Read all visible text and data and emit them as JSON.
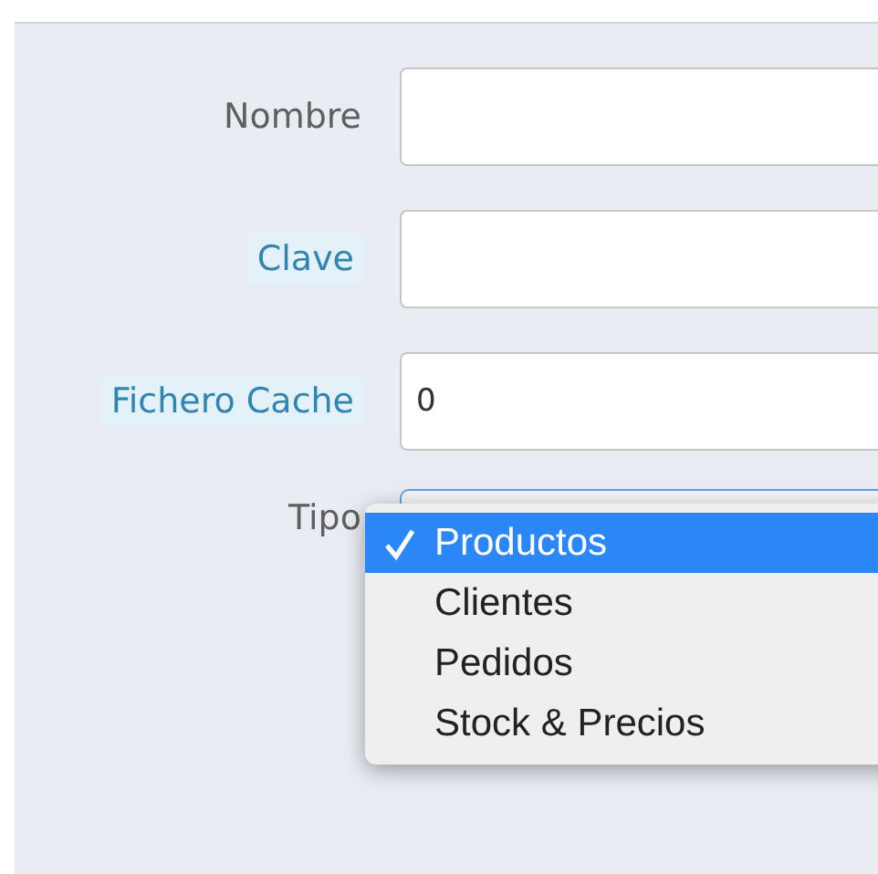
{
  "fields": [
    {
      "label": "Nombre",
      "kind": "plain"
    },
    {
      "label": "Clave",
      "kind": "hint"
    },
    {
      "label": "Fichero Cache",
      "kind": "hint",
      "value": "0"
    }
  ],
  "tipo": {
    "label": "Tipo",
    "options": [
      {
        "label": "Productos",
        "selected": true
      },
      {
        "label": "Clientes",
        "selected": false
      },
      {
        "label": "Pedidos",
        "selected": false
      },
      {
        "label": "Stock & Precios",
        "selected": false
      }
    ]
  }
}
